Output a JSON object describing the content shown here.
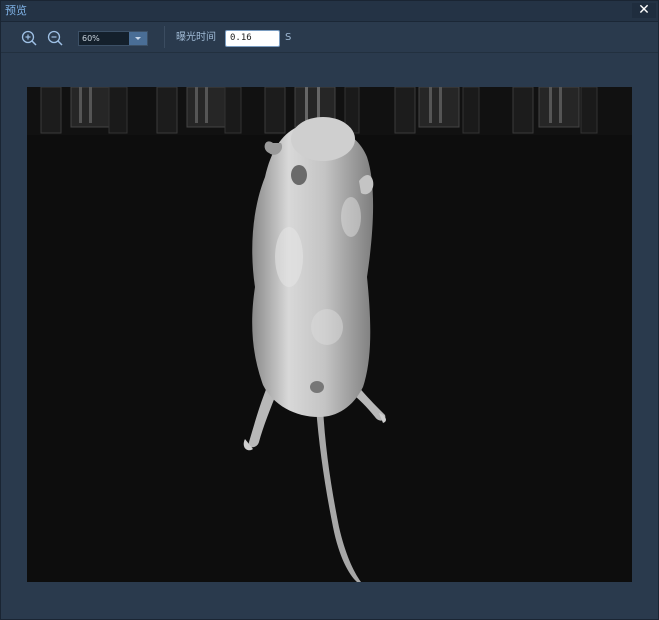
{
  "window": {
    "title": "预览",
    "close_glyph": "✕"
  },
  "toolbar": {
    "zoom_in_icon": "zoom-in-icon",
    "zoom_out_icon": "zoom-out-icon",
    "zoom_value": "60%",
    "exposure_label": "曝光时间",
    "exposure_value": "0.16",
    "exposure_unit": "S"
  },
  "colors": {
    "background": "#2a3a4d",
    "titlebar": "#243345",
    "title_text": "#7fb2e6",
    "accent": "#4a6e96",
    "image_background": "#0d0d0d"
  },
  "preview": {
    "image_subject": "mouse-specimen-grayscale"
  }
}
